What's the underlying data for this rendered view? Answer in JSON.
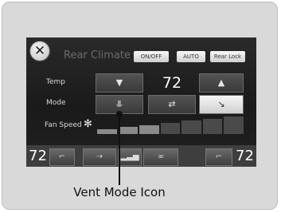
{
  "screen": {
    "title": "Rear Climate",
    "buttons": {
      "on_off": "ON/OFF",
      "auto": "AUTO",
      "rear_lock": "Rear Lock"
    }
  },
  "temp": {
    "label": "Temp",
    "value": "72",
    "down_icon": "down-triangle",
    "up_icon": "up-triangle"
  },
  "mode": {
    "label": "Mode",
    "options": [
      {
        "icon": "vent-mode",
        "glyph": "⥥"
      },
      {
        "icon": "bi-level-mode",
        "glyph": "⇄"
      },
      {
        "icon": "floor-mode",
        "glyph": "↘"
      }
    ],
    "selected_index": 2
  },
  "fan": {
    "label": "Fan Speed",
    "icon": "fan",
    "glyph": "✻",
    "level_filled": 3,
    "level_total": 7
  },
  "bottom": {
    "left_temp": "72",
    "right_temp": "72",
    "left_seat_glyph": "⌐",
    "mid_glyph": "⇢",
    "signal_glyph": "▂▃▅",
    "recirc_glyph": "∞",
    "right_seat_glyph": "⌐"
  },
  "caption": "Vent Mode Icon",
  "colors": {
    "screen_bg": "#1a1a1a",
    "active_button": "#e6e6e6",
    "frame_bg": "#d9d9d9"
  }
}
